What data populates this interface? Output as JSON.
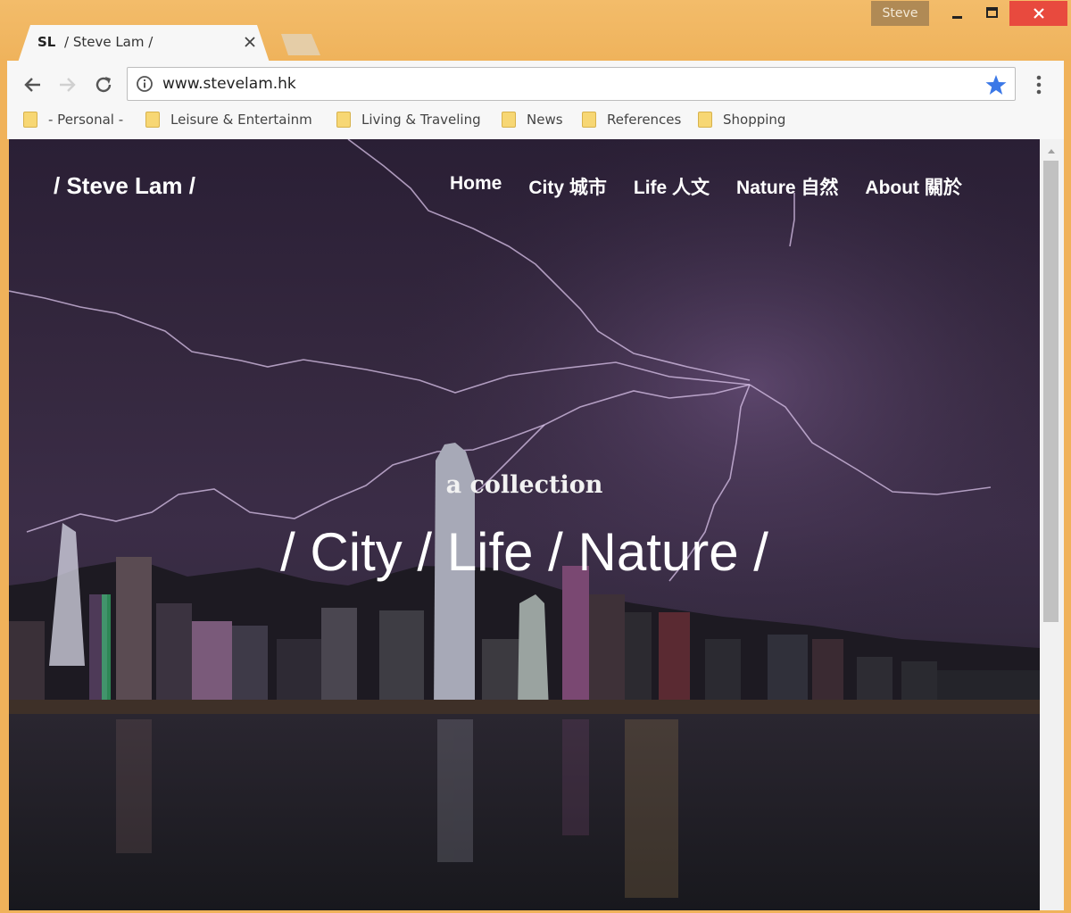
{
  "window": {
    "profile_name": "Steve"
  },
  "tab": {
    "favicon_text": "SL",
    "title": "/ Steve Lam /"
  },
  "omnibox": {
    "url": "www.stevelam.hk"
  },
  "bookmarks": [
    {
      "label": "- Personal -"
    },
    {
      "label": "Leisure & Entertainm"
    },
    {
      "label": "Living & Traveling"
    },
    {
      "label": "News"
    },
    {
      "label": "References"
    },
    {
      "label": "Shopping"
    }
  ],
  "site": {
    "logo": "/ Steve Lam /",
    "nav": [
      {
        "label": "Home"
      },
      {
        "label": "City 城市"
      },
      {
        "label": "Life 人文"
      },
      {
        "label": "Nature 自然"
      },
      {
        "label": "About 關於"
      }
    ],
    "tagline": "a collection",
    "hero_title": "/ City / Life / Nature /"
  },
  "colors": {
    "frame": "#f0b25a",
    "close_button": "#e84a3e",
    "star": "#3b78e7",
    "sky": "#35283f"
  },
  "icons": {
    "back": "back-arrow-icon",
    "forward": "forward-arrow-icon",
    "reload": "reload-icon",
    "info": "info-icon",
    "bookmark_star": "star-icon",
    "menu": "kebab-menu-icon",
    "folder": "folder-icon"
  }
}
